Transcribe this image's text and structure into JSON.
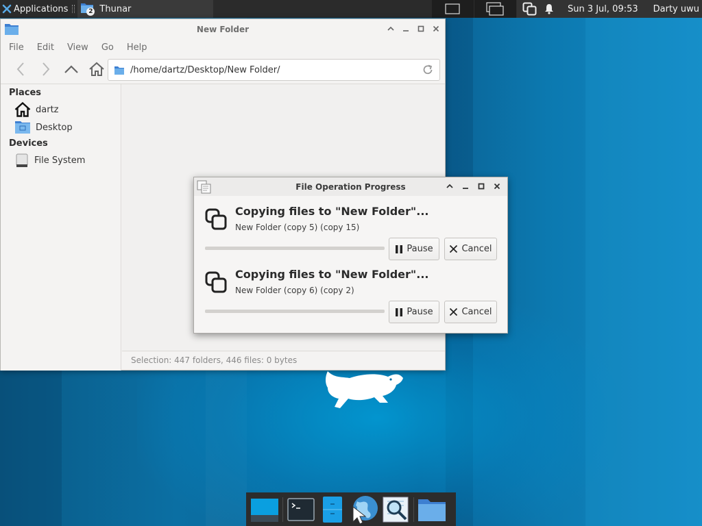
{
  "top_panel": {
    "applications_label": "Applications",
    "task_label": "Thunar",
    "task_badge": "2",
    "clock": "Sun  3 Jul, 09:53",
    "user": "Darty uwu"
  },
  "thunar": {
    "title": "New Folder",
    "menu": [
      "File",
      "Edit",
      "View",
      "Go",
      "Help"
    ],
    "path": "/home/dartz/Desktop/New Folder/",
    "sidebar": {
      "places_header": "Places",
      "places": [
        {
          "label": "dartz",
          "icon": "home-icon"
        },
        {
          "label": "Desktop",
          "icon": "desktop-folder-icon"
        }
      ],
      "devices_header": "Devices",
      "devices": [
        {
          "label": "File System",
          "icon": "drive-icon"
        }
      ]
    },
    "status": "Selection: 447 folders, 446 files: 0 bytes"
  },
  "dialog": {
    "title": "File Operation Progress",
    "operations": [
      {
        "title": "Copying files to \"New Folder\"...",
        "detail": "New Folder (copy 5) (copy 15)",
        "progress": 0.0
      },
      {
        "title": "Copying files to \"New Folder\"...",
        "detail": "New Folder (copy 6) (copy 2)",
        "progress": 0.0
      }
    ],
    "pause_label": "Pause",
    "cancel_label": "Cancel"
  },
  "dock": {
    "items": [
      "show-desktop-icon",
      "terminal-icon",
      "file-manager-icon",
      "web-browser-icon",
      "app-finder-icon",
      "folder-icon"
    ]
  },
  "colors": {
    "panel": "#2b2b2b",
    "desktop": "#0b6fa3",
    "accent": "#4d9fd6"
  }
}
